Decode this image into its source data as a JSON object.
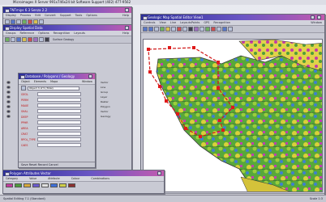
{
  "desktop": {
    "top_title": "Microimages X Server  991x746x24 bit  Software Support (402) 477-9562"
  },
  "small_window": {
    "title": "TNTmips 6.3  Senza 2.2"
  },
  "menus": {
    "main_items": [
      "Display",
      "Process",
      "Edit",
      "Convert",
      "Support",
      "Tools",
      "Options",
      "Help"
    ],
    "layer_items": [
      "Groups",
      "Reference",
      "Options",
      "Recognition",
      "Layouts",
      "Help"
    ],
    "editor_items": [
      "Object",
      "Elements",
      "Mapa",
      "Window"
    ],
    "view_items": [
      "Controls",
      "View",
      "Line",
      "LayoutsPoints",
      "GPS",
      "Recognition",
      "Window"
    ]
  },
  "layer_window": {
    "title": "Display Spatial Data",
    "layers": [
      "Vector",
      "Line",
      "Group",
      "Layer",
      "Raster",
      "Polygon",
      "Vector",
      "Geology"
    ],
    "group_label": "Surface Geology"
  },
  "attr_window": {
    "title": "Database / Polygons / Geology",
    "object_value": "Object 3 of 5 (Total)",
    "fields": [
      "GEOL",
      "PERM",
      "MAXE",
      "SHAL",
      "DEEP",
      "PPHR",
      "AREA",
      "CRAT",
      "RPOL_TYPE",
      "CAES"
    ],
    "footer": "Save   Reset   Record   Cancel"
  },
  "view_window": {
    "title": "Geologic Map  Spatial Editor  View1",
    "status_left": "Scale",
    "status_scale": "1:500000",
    "status_right": "Scale 1:500000",
    "bottom_status": "Scale 1:3"
  },
  "table_window": {
    "title": "Polygon Attributes  Vector",
    "columns": [
      "Category",
      "Value",
      "Attribute",
      "Colour",
      "Combinations"
    ],
    "swatches": [
      "#c23b9e",
      "#4d9b3a",
      "#d8a93b",
      "#6b5bcf",
      "#e0e0e0",
      "#3f6fd8",
      "#cfcf4a",
      "#8b3030"
    ]
  },
  "taskbar": {
    "left_text": "Spatial Editing 7.1 (Standard)",
    "right_text": "Scale 1:3"
  }
}
